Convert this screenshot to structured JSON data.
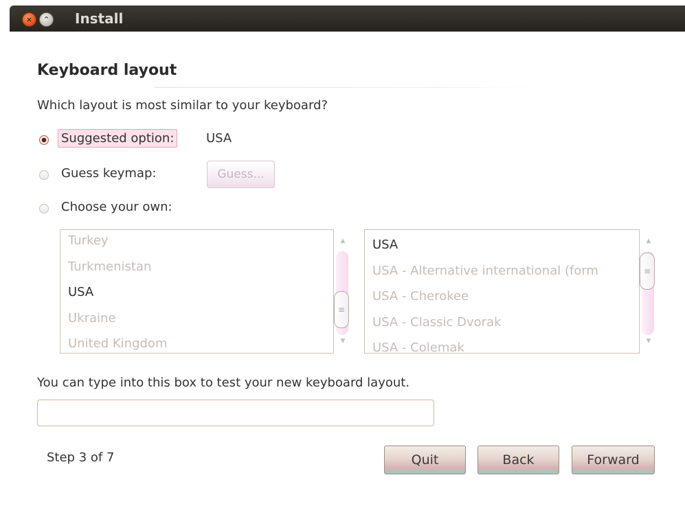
{
  "window": {
    "title": "Install",
    "close_glyph": "×",
    "maximize_glyph": "⌃"
  },
  "page": {
    "heading": "Keyboard layout",
    "question": "Which layout is most similar to your keyboard?"
  },
  "options": {
    "suggested_label": "Suggested option:",
    "suggested_value": "USA",
    "guess_label": "Guess keymap:",
    "guess_button": "Guess...",
    "choose_label": "Choose your own:",
    "selected": "suggested"
  },
  "layout_list": {
    "items": [
      "Turkey",
      "Turkmenistan",
      "USA",
      "Ukraine",
      "United Kingdom"
    ],
    "selected": "USA"
  },
  "variant_list": {
    "items": [
      "USA",
      "USA - Alternative international (form",
      "USA - Cherokee",
      "USA - Classic Dvorak",
      "USA - Colemak"
    ],
    "selected": "USA"
  },
  "test": {
    "hint": "You can type into this box to test your new keyboard layout.",
    "value": "",
    "placeholder": ""
  },
  "footer": {
    "step": "Step 3 of 7",
    "quit": "Quit",
    "back": "Back",
    "forward": "Forward"
  },
  "colors": {
    "titlebar": "#2f2c25",
    "close_button": "#df4b16",
    "selection_highlight": "#fbe2ea"
  }
}
